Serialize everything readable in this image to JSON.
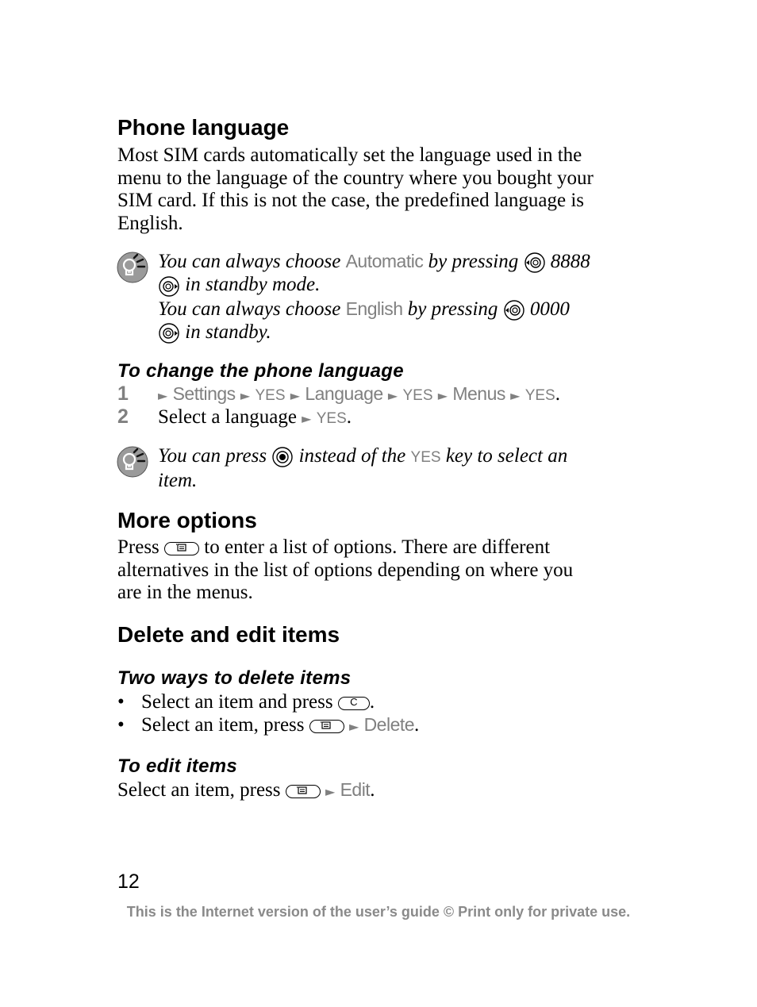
{
  "sections": {
    "phone_language": {
      "title": "Phone language",
      "paragraph_lines": [
        "Most SIM cards automatically set the language used in the",
        "menu to the language of the country where you bought your",
        "SIM card. If this is not the case, the predefined language is",
        "English."
      ],
      "tip": {
        "icon": "lightbulb-tip-icon",
        "line1_pre": "You can always choose ",
        "line1_key": "Automatic",
        "line1_post": " by pressing ",
        "line1_code": " 8888",
        "line2": " in standby mode.",
        "line3_pre": "You can always choose ",
        "line3_key": "English",
        "line3_post": " by pressing ",
        "line3_code": " 0000",
        "line4": " in standby."
      }
    },
    "change_language": {
      "title": "To change the phone language",
      "steps": [
        {
          "number": "1",
          "path": [
            "Settings",
            "YES",
            "Language",
            "YES",
            "Menus",
            "YES"
          ]
        },
        {
          "number": "2",
          "text": "Select a language ",
          "path": [
            "YES"
          ]
        }
      ],
      "tip": {
        "icon": "lightbulb-tip-icon",
        "pre": "You can press ",
        "mid": " instead of the ",
        "key": "YES",
        "post": " key to select an",
        "line2": "item."
      }
    },
    "more_options": {
      "title": "More options",
      "line1_pre": "Press ",
      "line1_post": " to enter a list of options. There are different",
      "line2": "alternatives in the list of options depending on where you",
      "line3": "are in the menus."
    },
    "delete_edit": {
      "title": "Delete and edit items",
      "two_ways": {
        "title": "Two ways to delete items",
        "bullets": [
          {
            "text": "Select an item and press ",
            "key_label": "C",
            "suffix": "."
          },
          {
            "text": "Select an item, press ",
            "menu_item": "Delete",
            "suffix": "."
          }
        ]
      },
      "edit": {
        "title": "To edit items",
        "text": "Select an item, press ",
        "menu_item": "Edit",
        "suffix": "."
      }
    }
  },
  "page_number": "12",
  "footer": "This is the Internet version of the user’s guide © Print only for private use.",
  "symbols": {
    "arrow": "►",
    "bullet": "•",
    "period": "."
  }
}
